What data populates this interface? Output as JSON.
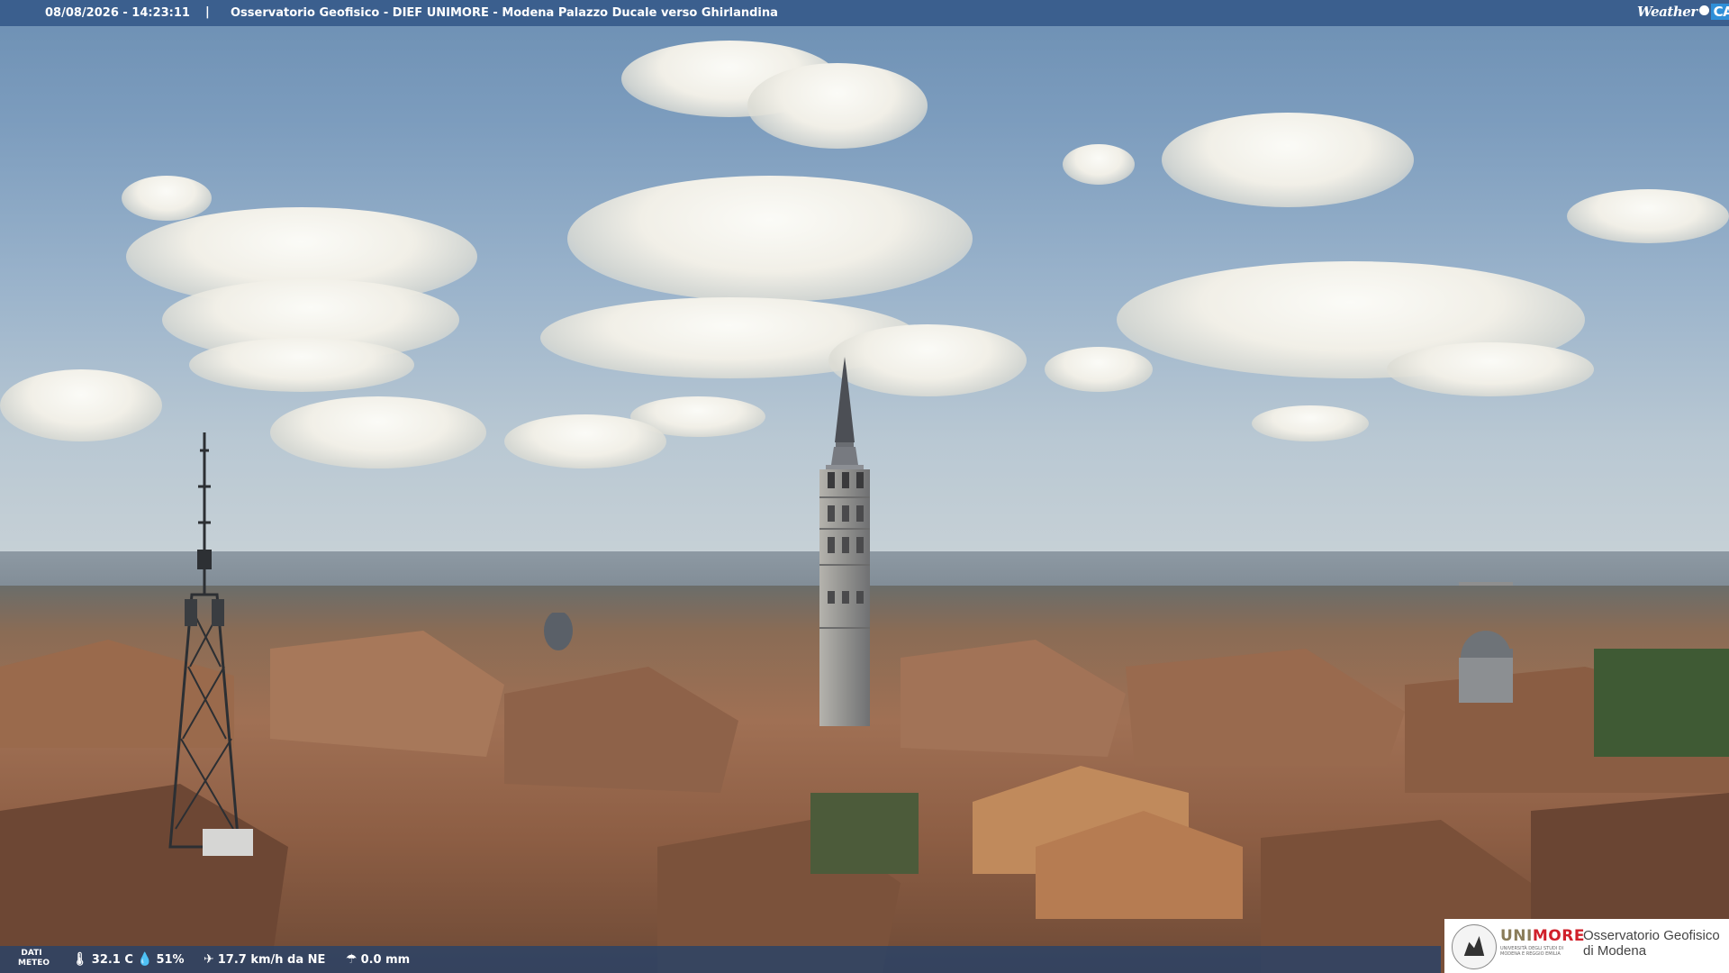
{
  "header": {
    "datetime": "08/08/2026 - 14:23:11",
    "separator": "|",
    "title": "Osservatorio Geofisico - DIEF UNIMORE - Modena Palazzo Ducale verso Ghirlandina",
    "brand_word1": "Weather",
    "brand_word2": "CAM"
  },
  "weather": {
    "dati_meteo_line1": "DATI",
    "dati_meteo_line2": "METEO",
    "temperature": "32.1 C",
    "humidity": "51%",
    "wind": "17.7 km/h da NE",
    "rain": "0.0 mm",
    "icons": [
      "thermometer-icon",
      "humidity-icon",
      "wind-icon",
      "rain-icon"
    ]
  },
  "logo": {
    "uni_part1": "UNI",
    "uni_part2": "MORE",
    "uni_subtitle": "UNIVERSITÀ DEGLI STUDI DI MODENA E REGGIO EMILIA",
    "observatory_line1": "Osservatorio Geofisico",
    "observatory_line2": "di Modena"
  },
  "colors": {
    "top_bar": "#3b5f8e",
    "more_red": "#d0202a",
    "cam_blue": "#2f8fd8"
  }
}
